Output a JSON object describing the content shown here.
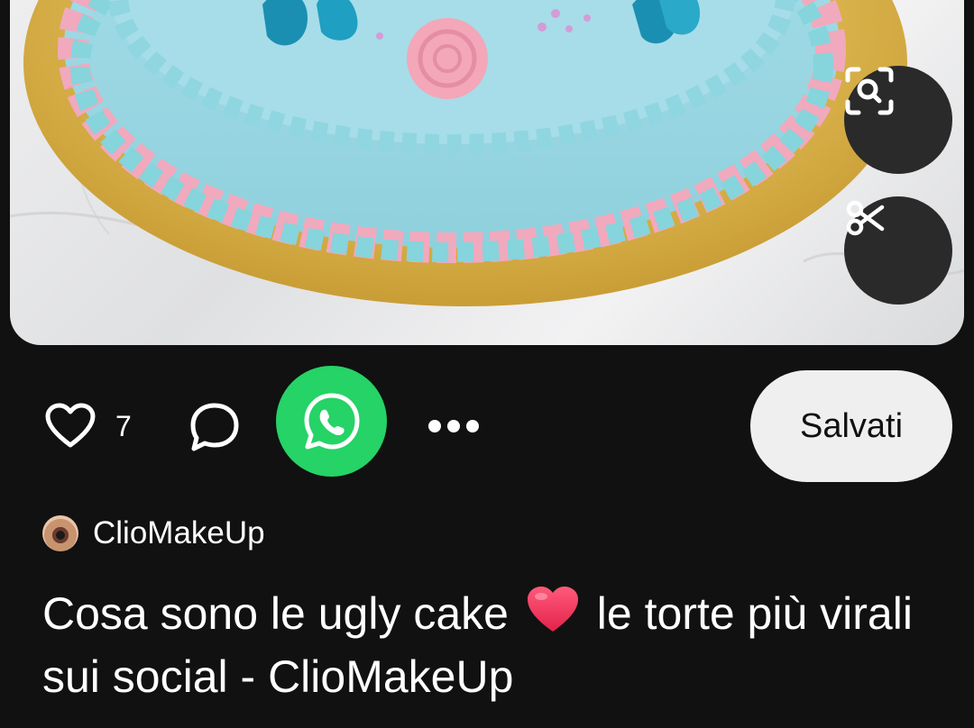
{
  "pin": {
    "image_alt": "",
    "visual_search_icon": "visual-search-icon",
    "cutout_icon": "scissors-icon"
  },
  "actions": {
    "like_icon": "heart-outline-icon",
    "like_count": "7",
    "comment_icon": "comment-bubble-icon",
    "share_icon": "whatsapp-icon",
    "more_icon": "more-horizontal-icon",
    "save_label": "Salvati"
  },
  "author": {
    "name": "ClioMakeUp"
  },
  "title": {
    "before": "Cosa sono le ugly cake",
    "emoji": "❤️",
    "after": "le torte più virali sui social - ClioMakeUp"
  },
  "colors": {
    "background": "#111111",
    "whatsapp": "#25d366",
    "save_button": "#efefef",
    "floating_button": "#2a2a2a"
  }
}
